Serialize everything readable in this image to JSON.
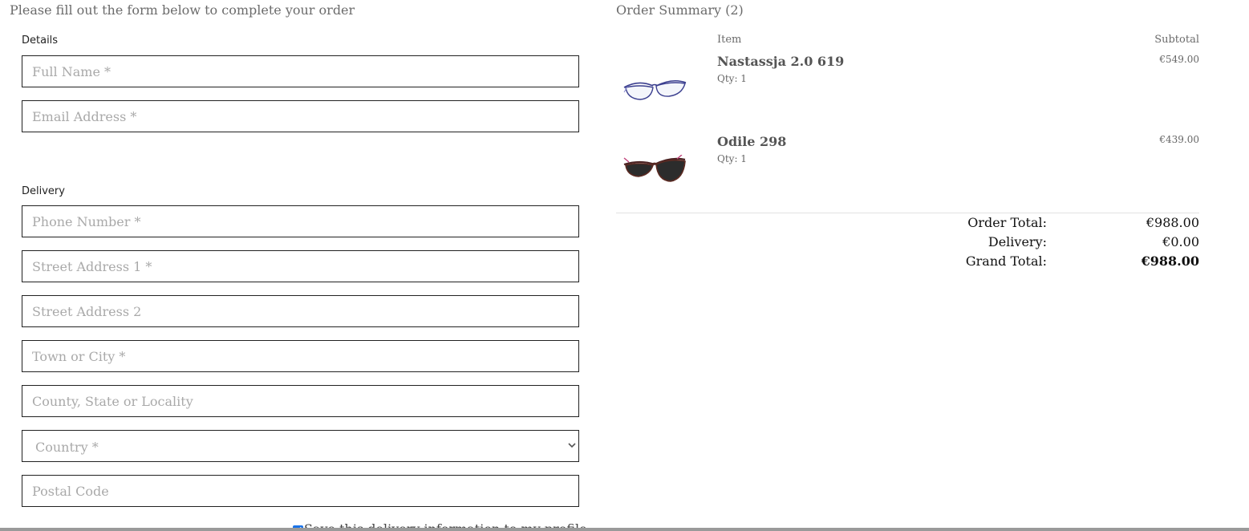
{
  "form": {
    "intro": "Please fill out the form below to complete your order",
    "details_label": "Details",
    "full_name_placeholder": "Full Name *",
    "email_placeholder": "Email Address *",
    "delivery_label": "Delivery",
    "phone_placeholder": "Phone Number *",
    "street1_placeholder": "Street Address 1 *",
    "street2_placeholder": "Street Address 2",
    "town_placeholder": "Town or City *",
    "county_placeholder": "County, State or Locality",
    "country_selected": "Country *",
    "postal_placeholder": "Postal Code",
    "save_delivery_label": "Save this delivery information to my profile",
    "save_delivery_checked": true
  },
  "summary": {
    "title": "Order Summary (2)",
    "col_item": "Item",
    "col_subtotal": "Subtotal",
    "items": [
      {
        "name": "Nastassja 2.0 619",
        "qty": "Qty: 1",
        "price": "€549.00",
        "icon": "eyeglasses-icon",
        "frame_color": "#3b3f8f"
      },
      {
        "name": "Odile 298",
        "qty": "Qty: 1",
        "price": "€439.00",
        "icon": "sunglasses-icon",
        "frame_color": "#3a2a2a"
      }
    ],
    "order_total_label": "Order Total:",
    "order_total_value": "€988.00",
    "delivery_label": "Delivery:",
    "delivery_value": "€0.00",
    "grand_total_label": "Grand Total:",
    "grand_total_value": "€988.00"
  }
}
